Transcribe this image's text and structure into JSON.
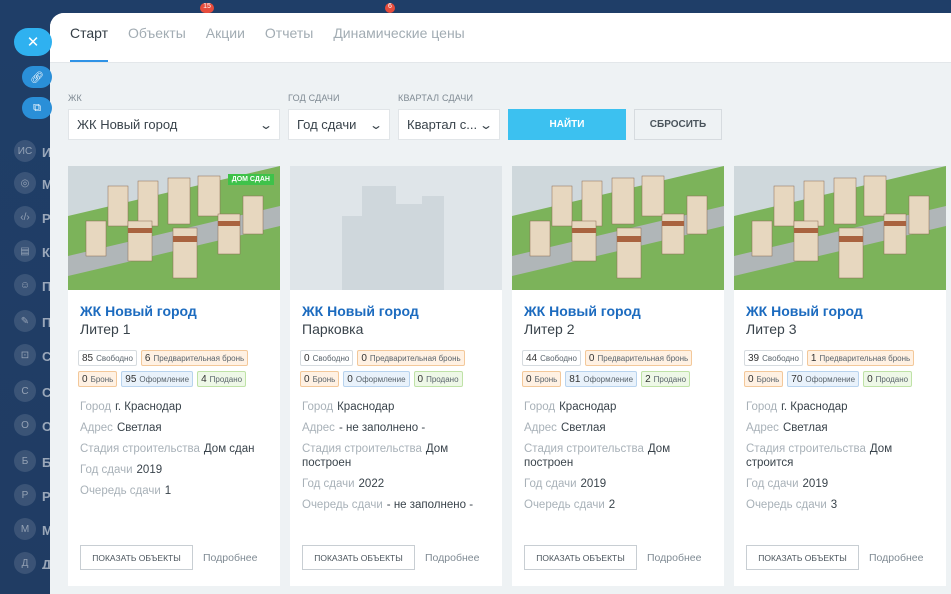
{
  "tabs": [
    {
      "label": "Старт",
      "active": true
    },
    {
      "label": "Объекты",
      "active": false
    },
    {
      "label": "Акции",
      "active": false
    },
    {
      "label": "Отчеты",
      "active": false
    },
    {
      "label": "Динамические цены",
      "active": false
    }
  ],
  "filters": {
    "complex": {
      "label": "ЖК",
      "value": "ЖК Новый город"
    },
    "year": {
      "label": "Год сдачи",
      "value": "Год сдачи"
    },
    "quarter": {
      "label": "Квартал сдачи",
      "value": "Квартал с..."
    },
    "find_label": "НАЙТИ",
    "reset_label": "СБРОСИТЬ"
  },
  "cards": [
    {
      "title": "ЖК Новый город",
      "subtitle": "Литер 1",
      "status_tag": "ДОМ СДАН",
      "badges": {
        "free": "85",
        "free_label": "Свободно",
        "prebook": "6",
        "prebook_label": "Предварительная бронь",
        "book": "0",
        "book_label": "Бронь",
        "reg": "95",
        "reg_label": "Оформление",
        "sold": "4",
        "sold_label": "Продано"
      },
      "info": {
        "city_k": "Город",
        "city_v": "г. Краснодар",
        "addr_k": "Адрес",
        "addr_v": "Светлая",
        "stage_k": "Стадия строительства",
        "stage_v": "Дом сдан",
        "year_k": "Год сдачи",
        "year_v": "2019",
        "queue_k": "Очередь сдачи",
        "queue_v": "1"
      },
      "show_label": "ПОКАЗАТЬ ОБЪЕКТЫ",
      "more_label": "Подробнее"
    },
    {
      "title": "ЖК Новый город",
      "subtitle": "Парковка",
      "badges": {
        "free": "0",
        "free_label": "Свободно",
        "prebook": "0",
        "prebook_label": "Предварительная бронь",
        "book": "0",
        "book_label": "Бронь",
        "reg": "0",
        "reg_label": "Оформление",
        "sold": "0",
        "sold_label": "Продано"
      },
      "info": {
        "city_k": "Город",
        "city_v": "Краснодар",
        "addr_k": "Адрес",
        "addr_v": "- не заполнено -",
        "stage_k": "Стадия строительства",
        "stage_v": "Дом построен",
        "year_k": "Год сдачи",
        "year_v": "2022",
        "queue_k": "Очередь сдачи",
        "queue_v": "- не заполнено -"
      },
      "show_label": "ПОКАЗАТЬ ОБЪЕКТЫ",
      "more_label": "Подробнее"
    },
    {
      "title": "ЖК Новый город",
      "subtitle": "Литер 2",
      "badges": {
        "free": "44",
        "free_label": "Свободно",
        "prebook": "0",
        "prebook_label": "Предварительная бронь",
        "book": "0",
        "book_label": "Бронь",
        "reg": "81",
        "reg_label": "Оформление",
        "sold": "2",
        "sold_label": "Продано"
      },
      "info": {
        "city_k": "Город",
        "city_v": "Краснодар",
        "addr_k": "Адрес",
        "addr_v": "Светлая",
        "stage_k": "Стадия строительства",
        "stage_v": "Дом построен",
        "year_k": "Год сдачи",
        "year_v": "2019",
        "queue_k": "Очередь сдачи",
        "queue_v": "2"
      },
      "show_label": "ПОКАЗАТЬ ОБЪЕКТЫ",
      "more_label": "Подробнее"
    },
    {
      "title": "ЖК Новый город",
      "subtitle": "Литер 3",
      "badges": {
        "free": "39",
        "free_label": "Свободно",
        "prebook": "1",
        "prebook_label": "Предварительная бронь",
        "book": "0",
        "book_label": "Бронь",
        "reg": "70",
        "reg_label": "Оформление",
        "sold": "0",
        "sold_label": "Продано"
      },
      "info": {
        "city_k": "Город",
        "city_v": "г. Краснодар",
        "addr_k": "Адрес",
        "addr_v": "Светлая",
        "stage_k": "Стадия строительства",
        "stage_v": "Дом строится",
        "year_k": "Год сдачи",
        "year_v": "2019",
        "queue_k": "Очередь сдачи",
        "queue_v": "3"
      },
      "show_label": "ПОКАЗАТЬ ОБЪЕКТЫ",
      "more_label": "Подробнее"
    }
  ],
  "sidebar": {
    "items": [
      "ИС",
      "М",
      "Р",
      "К",
      "П",
      "П",
      "С",
      "С",
      "О",
      "Б",
      "Р",
      "М",
      "Д"
    ]
  },
  "topbar": {
    "badge1": "15",
    "badge2": "6"
  },
  "colors": {
    "accent": "#3cc1f0",
    "link": "#1c6bbf",
    "done": "#3ec24a"
  }
}
